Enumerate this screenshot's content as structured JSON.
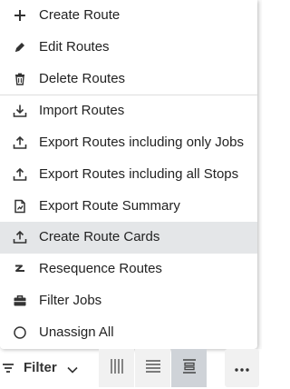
{
  "menu": {
    "items": [
      {
        "label": "Create Route",
        "icon": "plus-icon"
      },
      {
        "label": "Edit Routes",
        "icon": "pencil-icon"
      },
      {
        "label": "Delete Routes",
        "icon": "trash-icon"
      },
      {
        "label": "Import Routes",
        "icon": "import-icon"
      },
      {
        "label": "Export Routes including only Jobs",
        "icon": "export-icon"
      },
      {
        "label": "Export Routes including all Stops",
        "icon": "export-icon"
      },
      {
        "label": "Export Route Summary",
        "icon": "document-chart-icon"
      },
      {
        "label": "Create Route Cards",
        "icon": "export-icon",
        "active": true
      },
      {
        "label": "Resequence Routes",
        "icon": "resequence-icon"
      },
      {
        "label": "Filter Jobs",
        "icon": "briefcase-icon"
      },
      {
        "label": "Unassign All",
        "icon": "circle-icon"
      }
    ]
  },
  "toolbar": {
    "filter_label": "Filter",
    "view_buttons": [
      {
        "icon": "columns-icon",
        "selected": false
      },
      {
        "icon": "rows-icon",
        "selected": false
      },
      {
        "icon": "timeline-icon",
        "selected": true
      }
    ],
    "more_icon": "more-dots-icon"
  },
  "colors": {
    "active_row": "#e4e6e8",
    "selected_segment": "#cfd3d8",
    "icon": "#333333"
  }
}
